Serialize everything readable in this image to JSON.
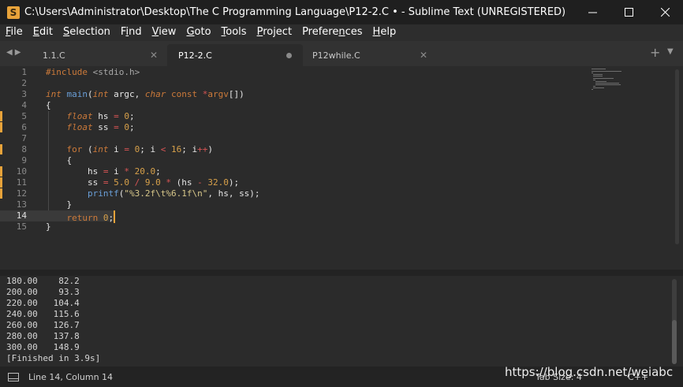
{
  "window": {
    "title": "C:\\Users\\Administrator\\Desktop\\The C Programming Language\\P12-2.C • - Sublime Text (UNREGISTERED)",
    "app_icon_letter": "S",
    "minimize_icon": "minimize-icon",
    "maximize_icon": "maximize-icon",
    "close_icon": "close-icon"
  },
  "menu": [
    {
      "pre": "",
      "ul": "F",
      "post": "ile"
    },
    {
      "pre": "",
      "ul": "E",
      "post": "dit"
    },
    {
      "pre": "",
      "ul": "S",
      "post": "election"
    },
    {
      "pre": "F",
      "ul": "i",
      "post": "nd"
    },
    {
      "pre": "",
      "ul": "V",
      "post": "iew"
    },
    {
      "pre": "",
      "ul": "G",
      "post": "oto"
    },
    {
      "pre": "",
      "ul": "T",
      "post": "ools"
    },
    {
      "pre": "",
      "ul": "P",
      "post": "roject"
    },
    {
      "pre": "Prefere",
      "ul": "n",
      "post": "ces"
    },
    {
      "pre": "",
      "ul": "H",
      "post": "elp"
    }
  ],
  "tabs": [
    {
      "label": "1.1.C",
      "active": false,
      "dirty": false
    },
    {
      "label": "P12-2.C",
      "active": true,
      "dirty": true
    },
    {
      "label": "P12while.C",
      "active": false,
      "dirty": false
    }
  ],
  "tab_controls": {
    "prev": "◀",
    "next": "▶",
    "new_tab": "+",
    "menu": "▼"
  },
  "editor": {
    "current_line": 14,
    "modified_lines": [
      5,
      6,
      8,
      10,
      11,
      12
    ],
    "lines": [
      [
        {
          "t": "#include ",
          "c": "pr"
        },
        {
          "t": "<stdio.h>",
          "c": "inc"
        }
      ],
      [],
      [
        {
          "t": "int",
          "c": "ty"
        },
        {
          "t": " ",
          "c": ""
        },
        {
          "t": "main",
          "c": "fn"
        },
        {
          "t": "(",
          "c": ""
        },
        {
          "t": "int",
          "c": "ty"
        },
        {
          "t": " argc, ",
          "c": ""
        },
        {
          "t": "char",
          "c": "ty"
        },
        {
          "t": " ",
          "c": ""
        },
        {
          "t": "const",
          "c": "kw"
        },
        {
          "t": " ",
          "c": ""
        },
        {
          "t": "*",
          "c": "op"
        },
        {
          "t": "argv",
          "c": "kw"
        },
        {
          "t": "[])",
          "c": ""
        }
      ],
      [
        {
          "t": "{",
          "c": ""
        }
      ],
      [
        {
          "t": "    ",
          "c": ""
        },
        {
          "t": "float",
          "c": "ty"
        },
        {
          "t": " hs ",
          "c": ""
        },
        {
          "t": "=",
          "c": "op"
        },
        {
          "t": " ",
          "c": ""
        },
        {
          "t": "0",
          "c": "num"
        },
        {
          "t": ";",
          "c": ""
        }
      ],
      [
        {
          "t": "    ",
          "c": ""
        },
        {
          "t": "float",
          "c": "ty"
        },
        {
          "t": " ss ",
          "c": ""
        },
        {
          "t": "=",
          "c": "op"
        },
        {
          "t": " ",
          "c": ""
        },
        {
          "t": "0",
          "c": "num"
        },
        {
          "t": ";",
          "c": ""
        }
      ],
      [],
      [
        {
          "t": "    ",
          "c": ""
        },
        {
          "t": "for",
          "c": "kw"
        },
        {
          "t": " (",
          "c": ""
        },
        {
          "t": "int",
          "c": "ty"
        },
        {
          "t": " i ",
          "c": ""
        },
        {
          "t": "=",
          "c": "op"
        },
        {
          "t": " ",
          "c": ""
        },
        {
          "t": "0",
          "c": "num"
        },
        {
          "t": "; i ",
          "c": ""
        },
        {
          "t": "<",
          "c": "op"
        },
        {
          "t": " ",
          "c": ""
        },
        {
          "t": "16",
          "c": "num"
        },
        {
          "t": "; i",
          "c": ""
        },
        {
          "t": "++",
          "c": "op"
        },
        {
          "t": ")",
          "c": ""
        }
      ],
      [
        {
          "t": "    {",
          "c": ""
        }
      ],
      [
        {
          "t": "        hs ",
          "c": ""
        },
        {
          "t": "=",
          "c": "op"
        },
        {
          "t": " i ",
          "c": ""
        },
        {
          "t": "*",
          "c": "op"
        },
        {
          "t": " ",
          "c": ""
        },
        {
          "t": "20.0",
          "c": "num"
        },
        {
          "t": ";",
          "c": ""
        }
      ],
      [
        {
          "t": "        ss ",
          "c": ""
        },
        {
          "t": "=",
          "c": "op"
        },
        {
          "t": " ",
          "c": ""
        },
        {
          "t": "5.0",
          "c": "num"
        },
        {
          "t": " ",
          "c": ""
        },
        {
          "t": "/",
          "c": "op"
        },
        {
          "t": " ",
          "c": ""
        },
        {
          "t": "9.0",
          "c": "num"
        },
        {
          "t": " ",
          "c": ""
        },
        {
          "t": "*",
          "c": "op"
        },
        {
          "t": " (hs ",
          "c": ""
        },
        {
          "t": "-",
          "c": "op"
        },
        {
          "t": " ",
          "c": ""
        },
        {
          "t": "32.0",
          "c": "num"
        },
        {
          "t": ");",
          "c": ""
        }
      ],
      [
        {
          "t": "        ",
          "c": ""
        },
        {
          "t": "printf",
          "c": "fn"
        },
        {
          "t": "(",
          "c": ""
        },
        {
          "t": "\"%3.2f\\t%6.1f\\n\"",
          "c": "str"
        },
        {
          "t": ", hs, ss);",
          "c": ""
        }
      ],
      [
        {
          "t": "    }",
          "c": ""
        }
      ],
      [
        {
          "t": "    ",
          "c": ""
        },
        {
          "t": "return",
          "c": "kw"
        },
        {
          "t": " ",
          "c": ""
        },
        {
          "t": "0",
          "c": "num"
        },
        {
          "t": ";",
          "c": ""
        }
      ],
      [
        {
          "t": "}",
          "c": ""
        }
      ]
    ]
  },
  "output": {
    "lines": [
      "180.00    82.2",
      "200.00    93.3",
      "220.00   104.4",
      "240.00   115.6",
      "260.00   126.7",
      "280.00   137.8",
      "300.00   148.9",
      "[Finished in 3.9s]"
    ]
  },
  "status": {
    "position": "Line 14, Column 14",
    "tab_size": "Tab Size: 4",
    "syntax": "C++"
  },
  "watermark": "https://blog.csdn.net/weiabc"
}
